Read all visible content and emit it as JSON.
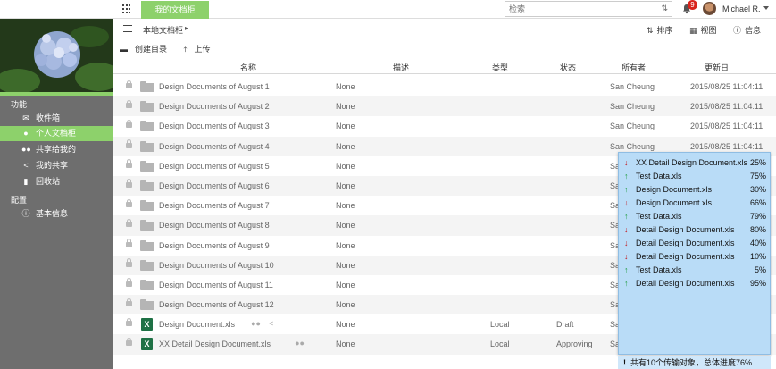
{
  "topbar": {
    "tab_label": "我的文档柜",
    "search_placeholder": "检索",
    "notification_count": "9",
    "username": "Michael R."
  },
  "sidebar": {
    "section_functions": "功能",
    "items": [
      {
        "label": "收件箱",
        "icon": "envelope-icon"
      },
      {
        "label": "个人文档柜",
        "icon": "user-icon",
        "active": true
      },
      {
        "label": "共享给我的",
        "icon": "users-icon"
      },
      {
        "label": "我的共享",
        "icon": "share-icon"
      },
      {
        "label": "回收站",
        "icon": "trash-icon"
      }
    ],
    "section_config": "配置",
    "config_items": [
      {
        "label": "基本信息",
        "icon": "info-icon"
      }
    ]
  },
  "toolbar": {
    "breadcrumb": "本地文档柜",
    "sort_label": "排序",
    "view_label": "视图",
    "info_label": "信息",
    "create_dir_label": "创建目录",
    "upload_label": "上传"
  },
  "table": {
    "columns": [
      "名称",
      "描述",
      "类型",
      "状态",
      "所有者",
      "更新日"
    ],
    "rows": [
      {
        "kind": "folder",
        "name": "Design Documents of August 1",
        "desc": "None",
        "type": "",
        "status": "",
        "owner": "San Cheung",
        "updated": "2015/08/25 11:04:11"
      },
      {
        "kind": "folder",
        "name": "Design Documents of August 2",
        "desc": "None",
        "type": "",
        "status": "",
        "owner": "San Cheung",
        "updated": "2015/08/25 11:04:11"
      },
      {
        "kind": "folder",
        "name": "Design Documents of August 3",
        "desc": "None",
        "type": "",
        "status": "",
        "owner": "San Cheung",
        "updated": "2015/08/25 11:04:11"
      },
      {
        "kind": "folder",
        "name": "Design Documents of August 4",
        "desc": "None",
        "type": "",
        "status": "",
        "owner": "San Cheung",
        "updated": "2015/08/25 11:04:11"
      },
      {
        "kind": "folder",
        "name": "Design Documents of August 5",
        "desc": "None",
        "type": "",
        "status": "",
        "owner": "Sa",
        "updated": ""
      },
      {
        "kind": "folder",
        "name": "Design Documents of August 6",
        "desc": "None",
        "type": "",
        "status": "",
        "owner": "Sa",
        "updated": ""
      },
      {
        "kind": "folder",
        "name": "Design Documents of August 7",
        "desc": "None",
        "type": "",
        "status": "",
        "owner": "Sa",
        "updated": ""
      },
      {
        "kind": "folder",
        "name": "Design Documents of August 8",
        "desc": "None",
        "type": "",
        "status": "",
        "owner": "Sa",
        "updated": ""
      },
      {
        "kind": "folder",
        "name": "Design Documents of August 9",
        "desc": "None",
        "type": "",
        "status": "",
        "owner": "Sa",
        "updated": ""
      },
      {
        "kind": "folder",
        "name": "Design Documents of August 10",
        "desc": "None",
        "type": "",
        "status": "",
        "owner": "Sa",
        "updated": ""
      },
      {
        "kind": "folder",
        "name": "Design Documents of August 11",
        "desc": "None",
        "type": "",
        "status": "",
        "owner": "Sa",
        "updated": ""
      },
      {
        "kind": "folder",
        "name": "Design Documents of August 12",
        "desc": "None",
        "type": "",
        "status": "",
        "owner": "Sa",
        "updated": ""
      },
      {
        "kind": "xls",
        "name": "Design Document.xls",
        "desc": "None",
        "type": "Local",
        "status": "Draft",
        "owner": "Sa",
        "updated": ""
      },
      {
        "kind": "xls",
        "name": "XX Detail Design Document.xls",
        "desc": "None",
        "type": "Local",
        "status": "Approving",
        "owner": "Sa",
        "updated": ""
      }
    ]
  },
  "transfers": {
    "items": [
      {
        "dir": "down",
        "name": "XX Detail Design Document.xls",
        "pct": "25%"
      },
      {
        "dir": "up",
        "name": "Test Data.xls",
        "pct": "75%"
      },
      {
        "dir": "up",
        "name": "Design Document.xls",
        "pct": "30%"
      },
      {
        "dir": "down",
        "name": "Design Document.xls",
        "pct": "66%"
      },
      {
        "dir": "up",
        "name": "Test Data.xls",
        "pct": "79%"
      },
      {
        "dir": "down",
        "name": "Detail Design Document.xls",
        "pct": "80%"
      },
      {
        "dir": "down",
        "name": "Detail Design Document.xls",
        "pct": "40%"
      },
      {
        "dir": "down",
        "name": "Detail Design Document.xls",
        "pct": "10%"
      },
      {
        "dir": "up",
        "name": "Test Data.xls",
        "pct": "5%"
      },
      {
        "dir": "up",
        "name": "Detail Design Document.xls",
        "pct": "95%"
      }
    ],
    "summary": "共有10个传输对象，总体进度76%"
  },
  "colors": {
    "accent": "#8dd16b",
    "sidebar": "#6e6e6e",
    "popup": "#b9dcf7",
    "download": "#c2171d",
    "upload": "#1a9a37"
  }
}
